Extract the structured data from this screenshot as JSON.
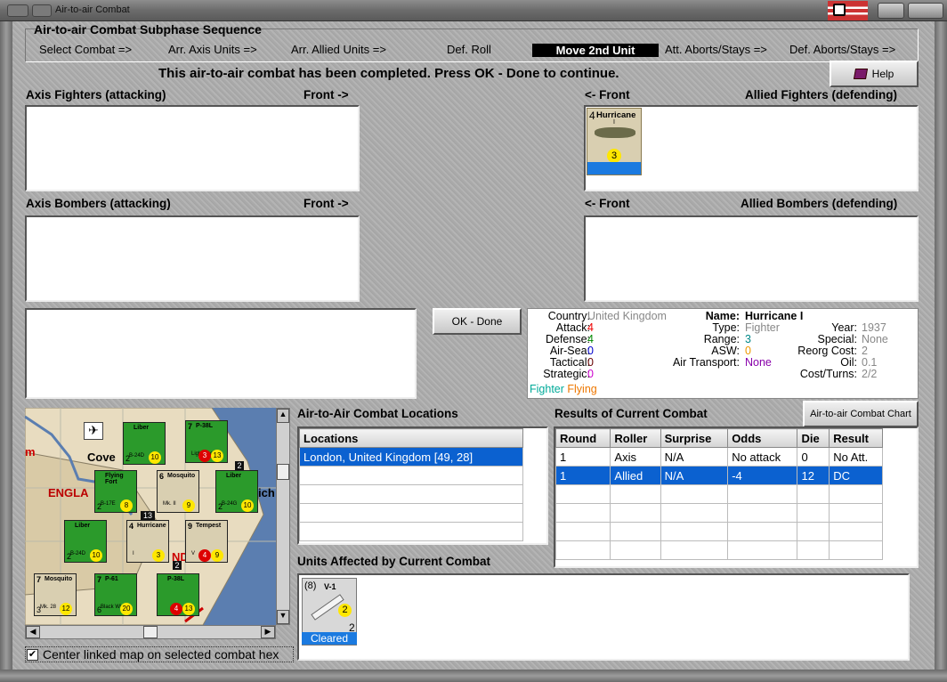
{
  "window": {
    "title": "Air-to-air Combat"
  },
  "subphase": {
    "title": "Air-to-air Combat Subphase Sequence",
    "steps": [
      "Select Combat =>",
      "Arr. Axis Units =>",
      "Arr. Allied Units =>",
      "Def. Roll",
      "Move 2nd Unit",
      "Att. Aborts/Stays =>",
      "Def. Aborts/Stays =>"
    ],
    "active": "Move 2nd Unit"
  },
  "message": "This air-to-air combat has been completed.  Press OK - Done to continue.",
  "help_label": "Help",
  "panels": {
    "axis_fighters": "Axis Fighters (attacking)",
    "axis_bombers": "Axis Bombers (attacking)",
    "allied_fighters": "Allied Fighters (defending)",
    "allied_bombers": "Allied Bombers (defending)",
    "front_right": "Front ->",
    "front_left": "<- Front"
  },
  "allied_fighter_counter": {
    "name": "Hurricane",
    "mark": "I",
    "attack": "4",
    "range": "3"
  },
  "ok_button": "OK - Done",
  "unit_info": {
    "country_label": "Country:",
    "country": "United Kingdom",
    "attack_label": "Attack:",
    "attack": "4",
    "defense_label": "Defense:",
    "defense": "4",
    "airsea_label": "Air-Sea:",
    "airsea": "0",
    "tactical_label": "Tactical:",
    "tactical": "0",
    "strategic_label": "Strategic:",
    "strategic": "0",
    "fighter_text": "Fighter",
    "flying_text": "Flying",
    "name_label": "Name:",
    "name": "Hurricane I",
    "type_label": "Type:",
    "type": "Fighter",
    "range_label": "Range:",
    "range": "3",
    "asw_label": "ASW:",
    "asw": "0",
    "air_transport_label": "Air Transport:",
    "air_transport": "None",
    "year_label": "Year:",
    "year": "1937",
    "special_label": "Special:",
    "special": "None",
    "reorg_label": "Reorg Cost:",
    "reorg": "2",
    "oil_label": "Oil:",
    "oil": "0.1",
    "cost_label": "Cost/Turns:",
    "cost": "2/2"
  },
  "locations": {
    "title": "Air-to-Air Combat Locations",
    "header": "Locations",
    "rows": [
      "London, United Kingdom [49, 28]"
    ]
  },
  "results": {
    "title": "Results of Current Combat",
    "chart_button": "Air-to-air Combat Chart",
    "headers": [
      "Round",
      "Roller",
      "Surprise",
      "Odds",
      "Die",
      "Result"
    ],
    "rows": [
      [
        "1",
        "Axis",
        "N/A",
        "No attack",
        "0",
        "No Att."
      ],
      [
        "1",
        "Allied",
        "N/A",
        "-4",
        "12",
        "DC"
      ]
    ]
  },
  "affected": {
    "title": "Units Affected by Current Combat",
    "unit": {
      "strength": "(8)",
      "name": "V-1",
      "value": "2",
      "range": "2",
      "status": "Cleared"
    }
  },
  "map": {
    "labels": {
      "coventry": "Cove",
      "england": "ENGLA",
      "m": "m",
      "ich": "ich",
      "nd": "ND"
    },
    "counters": [
      {
        "name": "Liber",
        "sub": "B-24D",
        "top": "",
        "a": "10",
        "b": "",
        "c": "2"
      },
      {
        "name": "P-38L",
        "sub": "Lightning",
        "top": "7",
        "a": "13",
        "b": "3",
        "c": ""
      },
      {
        "name": "Flying Fort",
        "sub": "B-17E",
        "top": "",
        "a": "8",
        "b": "",
        "c": "2"
      },
      {
        "name": "Mosquito",
        "sub": "Mk. II",
        "top": "6",
        "a": "9",
        "b": "",
        "c": ""
      },
      {
        "name": "Liber",
        "sub": "B-24G",
        "top": "",
        "a": "10",
        "b": "",
        "c": "2"
      },
      {
        "name": "Liber",
        "sub": "B-24D",
        "top": "",
        "a": "10",
        "b": "",
        "c": "2"
      },
      {
        "name": "Hurricane",
        "sub": "I",
        "top": "4",
        "a": "3",
        "b": "",
        "c": ""
      },
      {
        "name": "Tempest",
        "sub": "V",
        "top": "9",
        "a": "9",
        "b": "4",
        "c": ""
      },
      {
        "name": "Mosquito",
        "sub": "Mk. 28",
        "top": "7",
        "a": "12",
        "b": "",
        "c": "3"
      },
      {
        "name": "P-61",
        "sub": "Black Widow",
        "top": "7",
        "a": "20",
        "b": "",
        "c": "6"
      },
      {
        "name": "P-38L",
        "sub": "",
        "top": "",
        "a": "13",
        "b": "4",
        "c": ""
      }
    ],
    "stack_numbers": [
      "2",
      "13",
      "2"
    ]
  },
  "checkbox": {
    "label": "Center linked map on selected combat hex",
    "checked": true
  }
}
